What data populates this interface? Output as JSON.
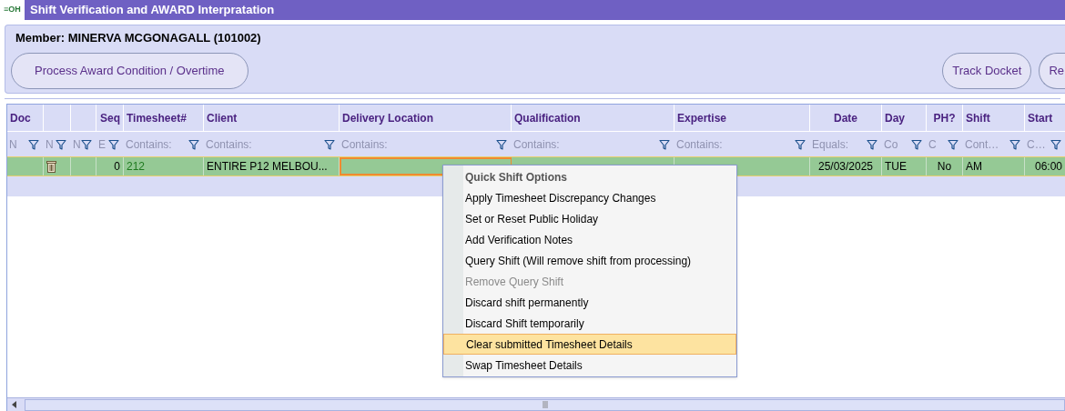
{
  "window": {
    "title": "Shift Verification and AWARD Interpratation",
    "logo": "≡OH"
  },
  "member": {
    "label": "Member: MINERVA MCGONAGALL (101002)"
  },
  "left_buttons": [
    {
      "label": "Process Award Condition / Overtime"
    }
  ],
  "right_buttons": [
    {
      "label": "Track Docket"
    },
    {
      "label": "Re"
    }
  ],
  "table": {
    "columns": [
      {
        "label": "Doc",
        "placeholder": "N"
      },
      {
        "placeholder": "N"
      },
      {
        "placeholder": "N"
      },
      {
        "label": "Seq",
        "placeholder": "E"
      },
      {
        "label": "Timesheet#",
        "placeholder": "Contains:"
      },
      {
        "label": "Client",
        "placeholder": "Contains:"
      },
      {
        "label": "Delivery Location",
        "placeholder": "Contains:"
      },
      {
        "label": "Qualification",
        "placeholder": "Contains:"
      },
      {
        "label": "Expertise",
        "placeholder": "Contains:"
      },
      {
        "label": "Date",
        "placeholder": "Equals:"
      },
      {
        "label": "Day",
        "placeholder": "Co"
      },
      {
        "label": "PH?",
        "placeholder": "C"
      },
      {
        "label": "Shift",
        "placeholder": "Cont…"
      },
      {
        "label": "Start",
        "placeholder": "C…"
      }
    ],
    "rows": [
      {
        "cells": [
          {
            "kind": "text"
          },
          {
            "kind": "trash"
          },
          {
            "kind": "text"
          },
          {
            "kind": "text",
            "text": "0"
          },
          {
            "kind": "link",
            "text": "212"
          },
          {
            "kind": "text",
            "text": "ENTIRE P12 MELBOU..."
          },
          {
            "kind": "text",
            "selected": true
          },
          {
            "kind": "text"
          },
          {
            "kind": "text"
          },
          {
            "kind": "text",
            "text": "25/03/2025"
          },
          {
            "kind": "text",
            "text": "TUE"
          },
          {
            "kind": "text",
            "text": "No"
          },
          {
            "kind": "text",
            "text": "AM"
          },
          {
            "kind": "text",
            "text": "06:00"
          }
        ]
      }
    ]
  },
  "context_menu": {
    "title": "Quick Shift Options",
    "items": [
      {
        "label": "Apply Timesheet Discrepancy Changes",
        "disabled": false,
        "selected": false
      },
      {
        "label": "Set or Reset Public Holiday",
        "disabled": false,
        "selected": false
      },
      {
        "label": "Add Verification Notes",
        "disabled": false,
        "selected": false
      },
      {
        "label": "Query Shift (Will remove shift from processing)",
        "disabled": false,
        "selected": false
      },
      {
        "label": "Remove Query Shift",
        "disabled": true,
        "selected": false
      },
      {
        "label": "Discard shift permanently",
        "disabled": false,
        "selected": false
      },
      {
        "label": "Discard Shift temporarily",
        "disabled": false,
        "selected": false
      },
      {
        "label": "Clear submitted Timesheet Details",
        "disabled": false,
        "selected": true
      },
      {
        "label": "Swap Timesheet Details",
        "disabled": false,
        "selected": false
      }
    ]
  }
}
